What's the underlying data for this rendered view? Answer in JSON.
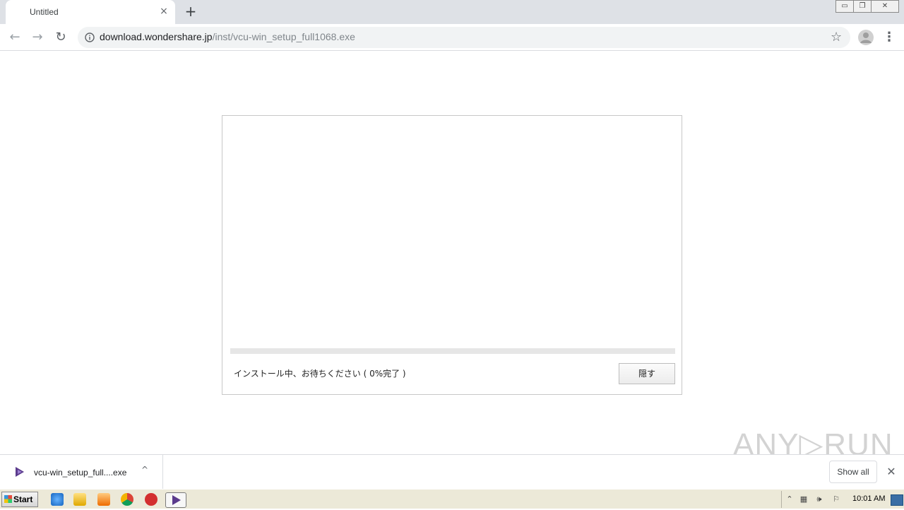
{
  "browser": {
    "tab_title": "Untitled",
    "tab_close_glyph": "×",
    "new_tab_glyph": "+",
    "window_controls": [
      "▭",
      "❐",
      "✕"
    ],
    "nav": {
      "back": "←",
      "forward": "→",
      "reload": "↻"
    },
    "url_host": "download.wondershare.jp",
    "url_path": "/inst/vcu-win_setup_full1068.exe",
    "bookmark_glyph": "☆",
    "menu_glyph": "⋮"
  },
  "installer": {
    "progress_fraction": 0,
    "status_text": "インストール中、お待ちください ( 0%完了 )",
    "hide_button_label": "隠す"
  },
  "watermark": "ANY▷RUN",
  "download_bar": {
    "file_name": "vcu-win_setup_full....exe",
    "chevron_glyph": "^",
    "show_all_label": "Show all",
    "close_glyph": "✕"
  },
  "taskbar": {
    "start_label": "Start",
    "clock": "10:01 AM",
    "accent": "#4a90e2"
  }
}
